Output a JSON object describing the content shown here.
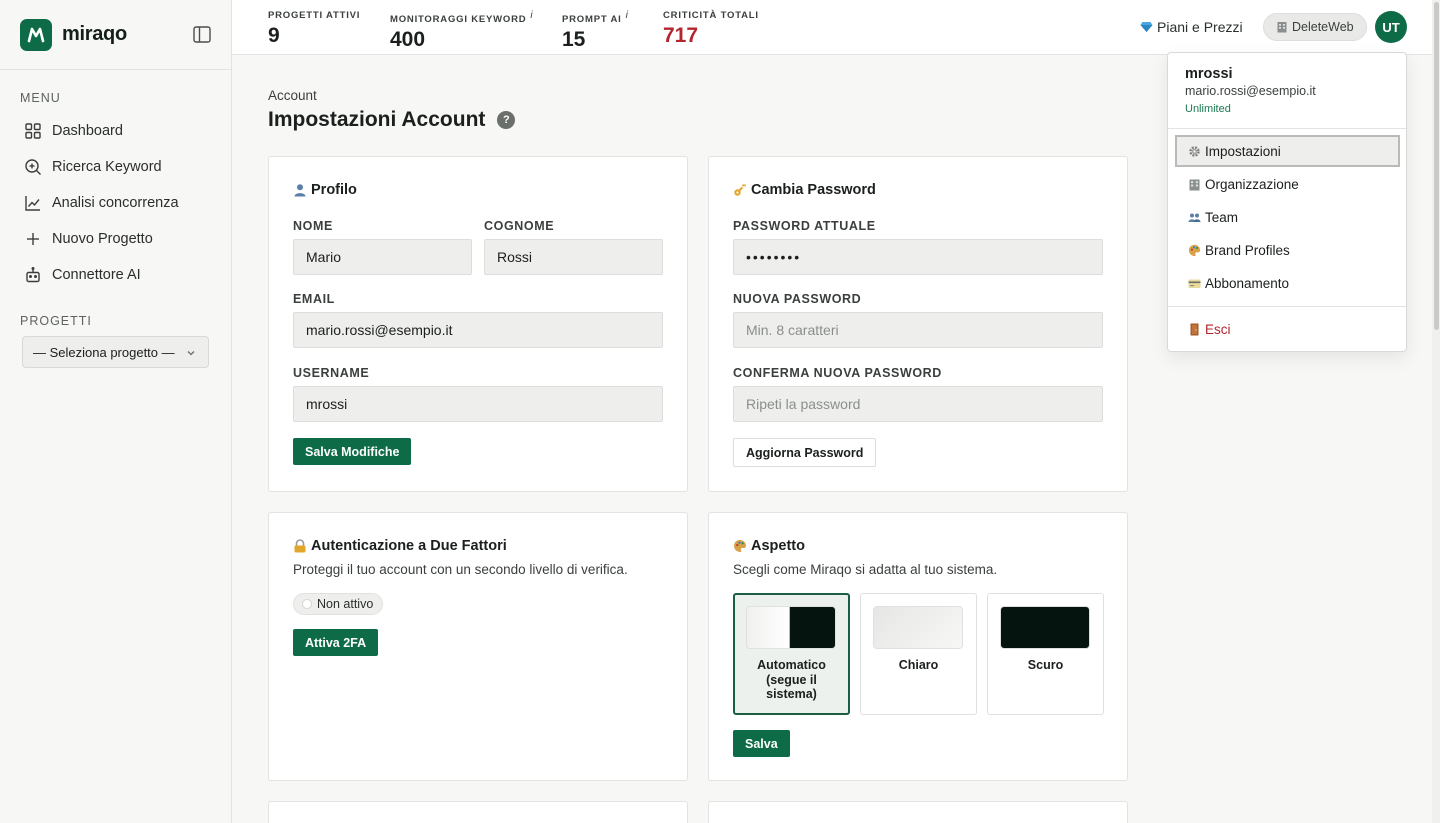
{
  "brand": {
    "name": "miraqo",
    "logo_letter": "M",
    "accent": "#0e6b47"
  },
  "sidebar": {
    "menu_title": "MENU",
    "items": [
      {
        "label": "Dashboard",
        "icon": "grid-icon"
      },
      {
        "label": "Ricerca Keyword",
        "icon": "search-plus-icon"
      },
      {
        "label": "Analisi concorrenza",
        "icon": "line-chart-icon"
      },
      {
        "label": "Nuovo Progetto",
        "icon": "plus-icon"
      },
      {
        "label": "Connettore AI",
        "icon": "robot-icon"
      }
    ],
    "projects_title": "PROGETTI",
    "project_select": "— Seleziona progetto —"
  },
  "topbar": {
    "stats": [
      {
        "label": "PROGETTI ATTIVI",
        "value": "9",
        "info": ""
      },
      {
        "label": "MONITORAGGI KEYWORD",
        "value": "400",
        "info": "i"
      },
      {
        "label": "PROMPT AI",
        "value": "15",
        "info": "i"
      },
      {
        "label": "CRITICITÀ TOTALI",
        "value": "717",
        "info": "",
        "color": "#b3262e"
      }
    ],
    "plans_label": "Piani e Prezzi",
    "org_label": "DeleteWeb",
    "avatar_initials": "UT"
  },
  "page": {
    "breadcrumb": "Account",
    "title": "Impostazioni Account",
    "help": "?"
  },
  "profile": {
    "title": "Profilo",
    "first_name_label": "NOME",
    "first_name": "Mario",
    "last_name_label": "COGNOME",
    "last_name": "Rossi",
    "email_label": "EMAIL",
    "email": "mario.rossi@esempio.it",
    "username_label": "USERNAME",
    "username": "mrossi",
    "save_label": "Salva Modifiche"
  },
  "password": {
    "title": "Cambia Password",
    "current_label": "PASSWORD ATTUALE",
    "current_value": "••••••••",
    "new_label": "NUOVA PASSWORD",
    "new_placeholder": "Min. 8 caratteri",
    "confirm_label": "CONFERMA NUOVA PASSWORD",
    "confirm_placeholder": "Ripeti la password",
    "update_label": "Aggiorna Password"
  },
  "twofa": {
    "title": "Autenticazione a Due Fattori",
    "description": "Proteggi il tuo account con un secondo livello di verifica.",
    "status": "Non attivo",
    "activate_label": "Attiva 2FA"
  },
  "appearance": {
    "title": "Aspetto",
    "description": "Scegli come Miraqo si adatta al tuo sistema.",
    "options": [
      {
        "label": "Automatico (segue il sistema)",
        "selected": true
      },
      {
        "label": "Chiaro",
        "selected": false
      },
      {
        "label": "Scuro",
        "selected": false
      }
    ],
    "save_label": "Salva"
  },
  "user_menu": {
    "username": "mrossi",
    "email": "mario.rossi@esempio.it",
    "plan": "Unlimited",
    "items": [
      {
        "label": "Impostazioni",
        "icon": "gear-icon",
        "active": true
      },
      {
        "label": "Organizzazione",
        "icon": "building-icon"
      },
      {
        "label": "Team",
        "icon": "people-icon"
      },
      {
        "label": "Brand Profiles",
        "icon": "palette-icon"
      },
      {
        "label": "Abbonamento",
        "icon": "credit-card-icon"
      }
    ],
    "logout_label": "Esci"
  }
}
